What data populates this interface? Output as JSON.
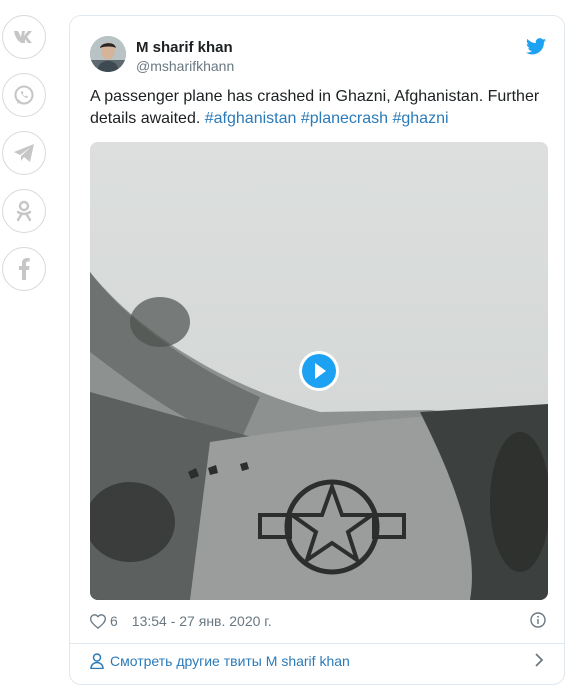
{
  "share_bar": {
    "items": [
      {
        "icon": "vk-icon"
      },
      {
        "icon": "whatsapp-icon"
      },
      {
        "icon": "telegram-icon"
      },
      {
        "icon": "odnoklassniki-icon"
      },
      {
        "icon": "facebook-icon"
      }
    ]
  },
  "tweet": {
    "author_name": "M sharif khan",
    "author_handle": "@msharifkhann",
    "text": "A passenger plane has crashed in Ghazni, Afghanistan. Further details awaited.",
    "hashtags": [
      "#afghanistan",
      "#planecrash",
      "#ghazni"
    ],
    "likes": "6",
    "timestamp": "13:54 - 27 янв. 2020 г.",
    "more_link": "Смотреть другие твиты M sharif khan"
  },
  "colors": {
    "link": "#2b7bb9",
    "twitter_blue": "#1da1f2",
    "muted": "#697882",
    "border": "#e1e8ed"
  }
}
